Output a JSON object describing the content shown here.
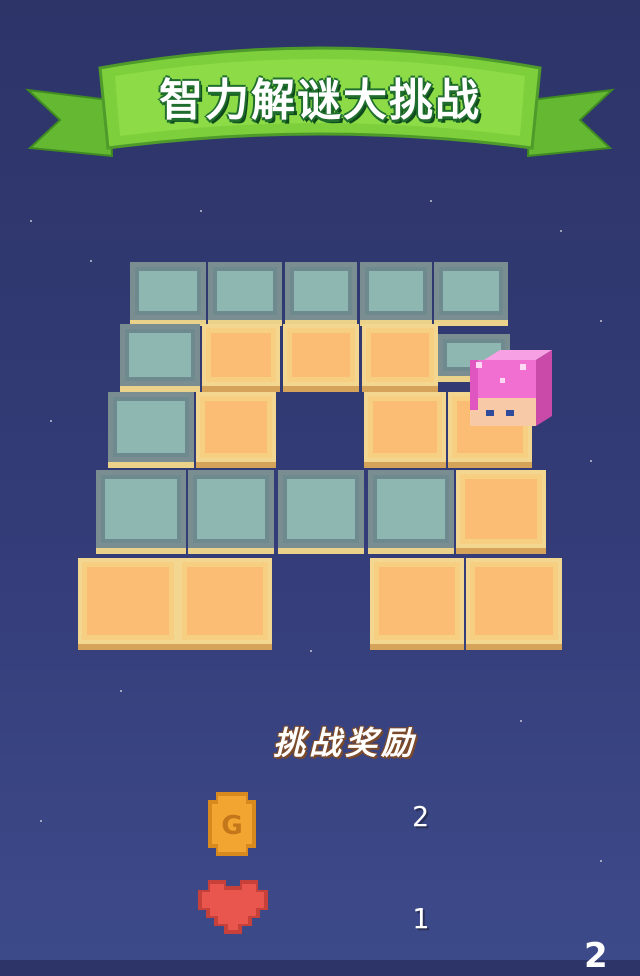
{
  "header": {
    "title": "智力解谜大挑战"
  },
  "rewards": {
    "title": "挑战奖励",
    "items": [
      {
        "icon": "gold-coin-icon",
        "value": "2"
      },
      {
        "icon": "heart-icon",
        "value": "1"
      }
    ]
  },
  "corner_counter": "2",
  "colors": {
    "background": "#343c78",
    "banner_green": "#7ecf3c",
    "tile_gray": "#8fb7b1",
    "tile_orange": "#fbbd73",
    "cube_pink": "#f06fd0",
    "coin": "#f2a531",
    "heart": "#e8564e"
  }
}
